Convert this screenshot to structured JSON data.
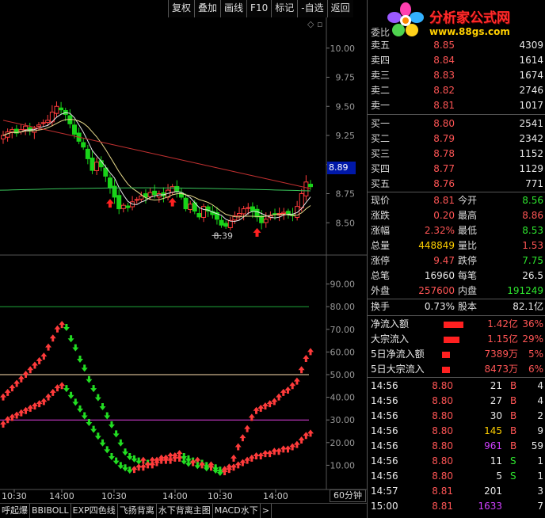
{
  "toolbar": {
    "buttons": [
      "复权",
      "叠加",
      "画线",
      "F10",
      "标记",
      "-自选",
      "返回"
    ]
  },
  "chart": {
    "price_ticks": [
      "10.00",
      "9.75",
      "9.50",
      "9.25",
      "9.00",
      "8.75",
      "8.50"
    ],
    "low_label": "8.39",
    "current_price_tag": "8.89",
    "indicator_ticks": [
      "90.00",
      "80.00",
      "70.00",
      "60.00",
      "50.00",
      "40.00",
      "30.00",
      "20.00",
      "10.00"
    ],
    "time_labels": [
      "10:30",
      "14:00",
      "10:30",
      "14:00",
      "10:30",
      "14:00"
    ],
    "period": "60分钟",
    "colors": {
      "up": "#ff3b3b",
      "down": "#19d419",
      "ma_white": "#e8e8e8",
      "ma_yellow": "#e6d98a",
      "ma_red": "#c03030",
      "ma_green": "#39c45a",
      "line80": "#1fa53a",
      "line50": "#ffe0b0",
      "line30": "#e040e0"
    }
  },
  "chart_data": [
    {
      "type": "candlestick",
      "title": "",
      "ylim": [
        8.25,
        10.25
      ],
      "y_ticks": [
        10.0,
        9.75,
        9.5,
        9.25,
        9.0,
        8.75,
        8.5
      ],
      "x_labels": [
        "10:30",
        "14:00",
        "10:30",
        "14:00",
        "10:30",
        "14:00"
      ],
      "closes": [
        9.25,
        9.28,
        9.3,
        9.27,
        9.3,
        9.33,
        9.29,
        9.31,
        9.34,
        9.36,
        9.38,
        9.45,
        9.5,
        9.47,
        9.43,
        9.35,
        9.26,
        9.2,
        9.15,
        9.05,
        8.95,
        9.02,
        8.98,
        8.9,
        8.8,
        8.72,
        8.62,
        8.65,
        8.63,
        8.68,
        8.7,
        8.73,
        8.72,
        8.76,
        8.74,
        8.75,
        8.73,
        8.78,
        8.81,
        8.77,
        8.72,
        8.62,
        8.66,
        8.6,
        8.55,
        8.64,
        8.6,
        8.57,
        8.53,
        8.48,
        8.47,
        8.52,
        8.56,
        8.58,
        8.62,
        8.63,
        8.6,
        8.55,
        8.5,
        8.53,
        8.56,
        8.57,
        8.58,
        8.59,
        8.57,
        8.56,
        8.64,
        8.75,
        8.85,
        8.81
      ],
      "low_point": 8.39,
      "last_price": 8.89,
      "arrows_at": [
        24,
        38,
        57
      ]
    },
    {
      "type": "line",
      "title": "",
      "ylim": [
        0,
        100
      ],
      "y_ticks": [
        90,
        80,
        70,
        60,
        50,
        40,
        30,
        20,
        10
      ],
      "levels": [
        80,
        50,
        30
      ],
      "series": [
        {
          "values": [
            40,
            42,
            44,
            46,
            48,
            50,
            52,
            54,
            56,
            58,
            62,
            66,
            70,
            72,
            71,
            66,
            62,
            57,
            53,
            48,
            44,
            40,
            36,
            32,
            28,
            24,
            20,
            16,
            14,
            13,
            12,
            12,
            11,
            12,
            12,
            13,
            13,
            14,
            14,
            15,
            14,
            13,
            12,
            12,
            11,
            10,
            10,
            9,
            8,
            8,
            9,
            13,
            18,
            22,
            26,
            31,
            34,
            35,
            36,
            37,
            38,
            40,
            42,
            43,
            45,
            47,
            52,
            57,
            60
          ]
        },
        {
          "values": [
            28,
            30,
            31,
            32,
            33,
            34,
            35,
            36,
            37,
            38,
            40,
            42,
            44,
            45,
            44,
            41,
            38,
            35,
            32,
            29,
            26,
            23,
            20,
            17,
            14,
            12,
            10,
            9,
            8,
            8,
            9,
            9,
            10,
            10,
            11,
            12,
            12,
            12,
            13,
            13,
            12,
            11,
            11,
            10,
            10,
            9,
            9,
            8,
            7,
            7,
            8,
            9,
            10,
            11,
            12,
            13,
            14,
            14,
            15,
            15,
            16,
            16,
            17,
            17,
            18,
            19,
            21,
            23,
            24
          ]
        }
      ]
    }
  ],
  "logo": {
    "title": "分析家公式网",
    "url": "www.88gs.com",
    "weibi": "委比"
  },
  "orderbook": {
    "asks": [
      {
        "label": "卖五",
        "price": "8.85",
        "vol": "4309"
      },
      {
        "label": "卖四",
        "price": "8.84",
        "vol": "1614"
      },
      {
        "label": "卖三",
        "price": "8.83",
        "vol": "1674"
      },
      {
        "label": "卖二",
        "price": "8.82",
        "vol": "2746"
      },
      {
        "label": "卖一",
        "price": "8.81",
        "vol": "1017"
      }
    ],
    "bids": [
      {
        "label": "买一",
        "price": "8.80",
        "vol": "2541"
      },
      {
        "label": "买二",
        "price": "8.79",
        "vol": "2342"
      },
      {
        "label": "买三",
        "price": "8.78",
        "vol": "1152"
      },
      {
        "label": "买四",
        "price": "8.77",
        "vol": "1129"
      },
      {
        "label": "买五",
        "price": "8.76",
        "vol": "771"
      }
    ]
  },
  "stats": [
    {
      "l1": "现价",
      "v1": "8.81",
      "c1": "red",
      "l2": "今开",
      "v2": "8.56",
      "c2": "green"
    },
    {
      "l1": "涨跌",
      "v1": "0.20",
      "c1": "red",
      "l2": "最高",
      "v2": "8.86",
      "c2": "red"
    },
    {
      "l1": "涨幅",
      "v1": "2.32%",
      "c1": "red",
      "l2": "最低",
      "v2": "8.53",
      "c2": "green"
    },
    {
      "l1": "总量",
      "v1": "448849",
      "c1": "yellow",
      "l2": "量比",
      "v2": "1.53",
      "c2": "red"
    },
    {
      "l1": "涨停",
      "v1": "9.47",
      "c1": "red",
      "l2": "跌停",
      "v2": "7.75",
      "c2": "green"
    },
    {
      "l1": "总笔",
      "v1": "16960",
      "c1": "white",
      "l2": "每笔",
      "v2": "26.5",
      "c2": "white"
    },
    {
      "l1": "外盘",
      "v1": "257600",
      "c1": "red",
      "l2": "内盘",
      "v2": "191249",
      "c2": "green"
    }
  ],
  "turnover": {
    "l1": "换手",
    "v1": "0.73%",
    "l2": "股本",
    "v2": "82.1亿"
  },
  "flows": [
    {
      "label": "净流入额",
      "value": "1.42亿",
      "pct": "36%",
      "bar": 0.36
    },
    {
      "label": "大宗流入",
      "value": "1.15亿",
      "pct": "29%",
      "bar": 0.29
    },
    {
      "label": "5日净流入额",
      "value": "7389万",
      "pct": "5%",
      "bar": 0.05
    },
    {
      "label": "5日大宗流入",
      "value": "8473万",
      "pct": "6%",
      "bar": 0.06
    }
  ],
  "ticks": [
    {
      "time": "14:56",
      "price": "8.80",
      "vol": "21",
      "vc": "white",
      "bs": "B",
      "bc": "red",
      "n": "4"
    },
    {
      "time": "14:56",
      "price": "8.80",
      "vol": "27",
      "vc": "white",
      "bs": "B",
      "bc": "red",
      "n": "4"
    },
    {
      "time": "14:56",
      "price": "8.80",
      "vol": "30",
      "vc": "white",
      "bs": "B",
      "bc": "red",
      "n": "2"
    },
    {
      "time": "14:56",
      "price": "8.80",
      "vol": "145",
      "vc": "yellow",
      "bs": "B",
      "bc": "red",
      "n": "9"
    },
    {
      "time": "14:56",
      "price": "8.80",
      "vol": "961",
      "vc": "purple",
      "bs": "B",
      "bc": "red",
      "n": "59"
    },
    {
      "time": "14:56",
      "price": "8.80",
      "vol": "11",
      "vc": "white",
      "bs": "S",
      "bc": "green",
      "n": "1"
    },
    {
      "time": "14:56",
      "price": "8.80",
      "vol": "5",
      "vc": "white",
      "bs": "S",
      "bc": "green",
      "n": "1"
    },
    {
      "time": "14:57",
      "price": "8.81",
      "vol": "201",
      "vc": "white",
      "bs": "",
      "bc": "white",
      "n": "3"
    },
    {
      "time": "15:00",
      "price": "8.81",
      "vol": "1633",
      "vc": "purple",
      "bs": "",
      "bc": "white",
      "n": "7"
    }
  ],
  "tabs": [
    "呼起爆",
    "BBIBOLL",
    "EXP四色线",
    "飞扬背离",
    "水下背离主图",
    "MACD水下",
    ">"
  ]
}
